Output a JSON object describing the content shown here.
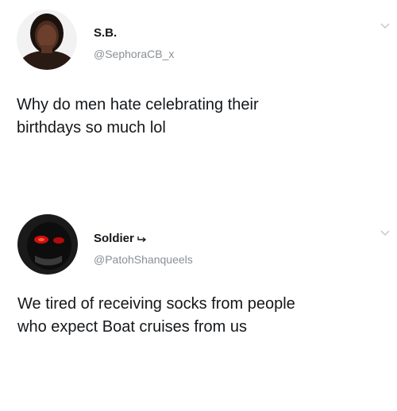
{
  "tweets": [
    {
      "display_name": "S.B.",
      "handle": "@SephoraCB_x",
      "text": "Why do men hate celebrating their\nbirthdays so much lol",
      "avatar_icon": "profile-photo-woman",
      "menu_icon": "chevron-down-icon"
    },
    {
      "display_name": "Soldier",
      "handle": "@PatohShanqueels",
      "text": "We tired of receiving socks from people\nwho expect Boat cruises from us",
      "avatar_icon": "profile-photo-man-red-glow",
      "name_badge_icon": "reply-arrow-icon",
      "menu_icon": "chevron-down-icon"
    }
  ],
  "colors": {
    "text": "#14171a",
    "handle": "#8a8f94",
    "background": "#ffffff",
    "chevron": "#c4c8cc"
  }
}
